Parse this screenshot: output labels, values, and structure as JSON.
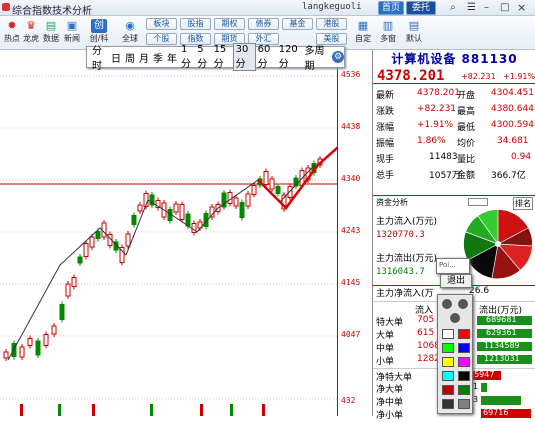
{
  "window": {
    "title": "综合指数技术分析",
    "user": "langkeguoli",
    "btn_home": "首页",
    "btn_trade": "委托"
  },
  "toolbar": {
    "tools": [
      {
        "icon": "hotspot-icon",
        "label": "热点",
        "glyph": "✹"
      },
      {
        "icon": "dragon-tiger-icon",
        "label": "龙虎",
        "glyph": "♛"
      },
      {
        "icon": "data-icon",
        "label": "数据",
        "glyph": "▤"
      },
      {
        "icon": "news-icon",
        "label": "新闻",
        "glyph": "▣"
      },
      {
        "icon": "chuangye-icon",
        "label": "创/科",
        "glyph": "创"
      },
      {
        "icon": "globe-icon",
        "label": "全球",
        "glyph": "◉"
      }
    ],
    "menu_top": [
      "板块",
      "股指",
      "期权",
      "债券",
      "基金",
      "港股"
    ],
    "menu_bottom": [
      "个股",
      "指数",
      "期货",
      "外汇",
      "美股"
    ],
    "right_tools": [
      {
        "icon": "customize-icon",
        "label": "自定"
      },
      {
        "icon": "multi-screen-icon",
        "label": "多窗"
      },
      {
        "icon": "default-icon",
        "label": "默认"
      }
    ]
  },
  "period": {
    "items": [
      "分时",
      "日",
      "周",
      "月",
      "季",
      "年",
      "1分",
      "5分",
      "15分",
      "30分",
      "60分",
      "120分",
      "多周期"
    ],
    "selected": "30分"
  },
  "yaxis": {
    "labels": [
      "4536",
      "4438",
      "4340",
      "4243",
      "4145",
      "4047",
      "432"
    ]
  },
  "stock": {
    "title": "计算机设备 881130",
    "price": "4378.201",
    "change": "+82.231",
    "pct": "+1.91%"
  },
  "quote": [
    {
      "l1": "最新",
      "v1": "4378.201",
      "l2": "开盘",
      "v2": "4304.451"
    },
    {
      "l1": "涨跌",
      "v1": "+82.231",
      "l2": "最高",
      "v2": "4380.644"
    },
    {
      "l1": "涨幅",
      "v1": "+1.91%",
      "l2": "最低",
      "v2": "4300.594"
    },
    {
      "l1": "振幅",
      "v1": "1.86%",
      "l2": "均价",
      "v2": "34.681"
    },
    {
      "l1": "现手",
      "v1": "11483",
      "l2": "量比",
      "v2": "0.94"
    },
    {
      "l1": "总手",
      "v1": "1057万",
      "l2": "金额",
      "v2": "366.7亿"
    }
  ],
  "funds": {
    "title": "资金分析",
    "rank": "排名",
    "inflow_label": "主力流入(万元)",
    "inflow_value": "1320770.3",
    "outflow_label": "主力流出(万元)",
    "outflow_value": "1316043.7",
    "net_label": "主力净流入(万",
    "net_value": "26.6",
    "col_in": "流入",
    "col_out": "流出(万元)",
    "orders": [
      {
        "name": "特大单",
        "in": "705",
        "out": "689681"
      },
      {
        "name": "大单",
        "in": "615",
        "out": "629361"
      },
      {
        "name": "中单",
        "in": "1068",
        "out": "1134589"
      },
      {
        "name": "小单",
        "in": "1282",
        "out": "1213031"
      }
    ],
    "net": [
      {
        "name": "净特大单",
        "val": "15947"
      },
      {
        "name": "净大单",
        "val": "1"
      },
      {
        "name": "净中单",
        "val": "3"
      },
      {
        "name": "净小单",
        "val": "69716"
      }
    ]
  },
  "popup": {
    "partial": "Poi...",
    "exit": "退出",
    "colors": [
      "#ffffff",
      "#ff0000",
      "#00ff00",
      "#0000ff",
      "#ffff00",
      "#ff00ff",
      "#00ffff",
      "#000000",
      "#c00000",
      "#008000",
      "#333333",
      "#808080"
    ]
  },
  "chart_data": {
    "type": "candlestick"
  }
}
